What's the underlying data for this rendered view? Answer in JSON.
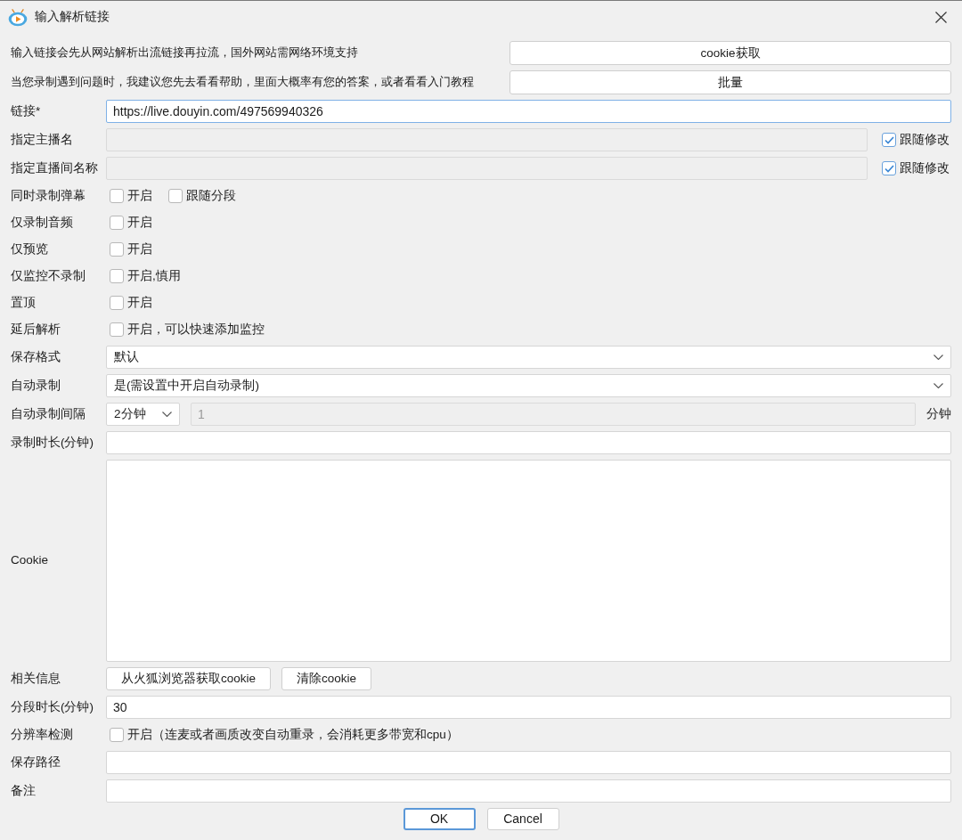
{
  "window": {
    "title": "输入解析链接"
  },
  "notices": [
    {
      "text": "输入链接会先从网站解析出流链接再拉流，国外网站需网络环境支持",
      "button": "cookie获取"
    },
    {
      "text": "当您录制遇到问题时，我建议您先去看看帮助，里面大概率有您的答案，或者看看入门教程",
      "button": "批量"
    }
  ],
  "fields": [
    {
      "kind": "text",
      "label": "链接*",
      "value": "https://live.douyin.com/497569940326",
      "focused": true,
      "disabled": false
    },
    {
      "kind": "text",
      "label": "指定主播名",
      "focused": false,
      "disabled": true,
      "follow": {
        "label": "跟随修改",
        "checked": true
      }
    },
    {
      "kind": "text",
      "label": "指定直播间名称",
      "focused": false,
      "disabled": true,
      "follow": {
        "label": "跟随修改",
        "checked": true
      }
    },
    {
      "kind": "checks",
      "label": "同时录制弹幕",
      "options": [
        {
          "label": "开启",
          "checked": false
        },
        {
          "label": "跟随分段",
          "checked": false
        }
      ]
    },
    {
      "kind": "checks",
      "label": "仅录制音频",
      "options": [
        {
          "label": "开启",
          "checked": false
        }
      ]
    },
    {
      "kind": "checks",
      "label": "仅预览",
      "options": [
        {
          "label": "开启",
          "checked": false
        }
      ]
    },
    {
      "kind": "checks",
      "label": "仅监控不录制",
      "options": [
        {
          "label": "开启,慎用",
          "checked": false
        }
      ]
    },
    {
      "kind": "checks",
      "label": "置顶",
      "options": [
        {
          "label": "开启",
          "checked": false
        }
      ]
    },
    {
      "kind": "checks",
      "label": "延后解析",
      "options": [
        {
          "label": "开启，可以快速添加监控",
          "checked": false
        }
      ]
    },
    {
      "kind": "select",
      "label": "保存格式",
      "value": "默认"
    },
    {
      "kind": "select",
      "label": "自动录制",
      "value": "是(需设置中开启自动录制)"
    },
    {
      "kind": "interval",
      "label": "自动录制间隔",
      "choice": "2分钟",
      "value": "1",
      "disabled": true,
      "unit": "分钟"
    },
    {
      "kind": "text",
      "label": "录制时长(分钟)",
      "focused": false,
      "disabled": false
    },
    {
      "kind": "textarea",
      "label": "Cookie"
    },
    {
      "kind": "buttons",
      "label": "相关信息",
      "buttons": [
        "从火狐浏览器获取cookie",
        "清除cookie"
      ]
    },
    {
      "kind": "text",
      "label": "分段时长(分钟)",
      "value": "30",
      "focused": false,
      "disabled": false
    },
    {
      "kind": "checks",
      "label": "分辨率检测",
      "options": [
        {
          "label": "开启（连麦或者画质改变自动重录，会消耗更多带宽和cpu）",
          "checked": false
        }
      ]
    },
    {
      "kind": "text",
      "label": "保存路径",
      "focused": false,
      "disabled": false
    },
    {
      "kind": "text",
      "label": "备注",
      "focused": false,
      "disabled": false
    }
  ],
  "buttons": [
    {
      "label": "OK",
      "default": true
    },
    {
      "label": "Cancel",
      "default": false
    }
  ]
}
